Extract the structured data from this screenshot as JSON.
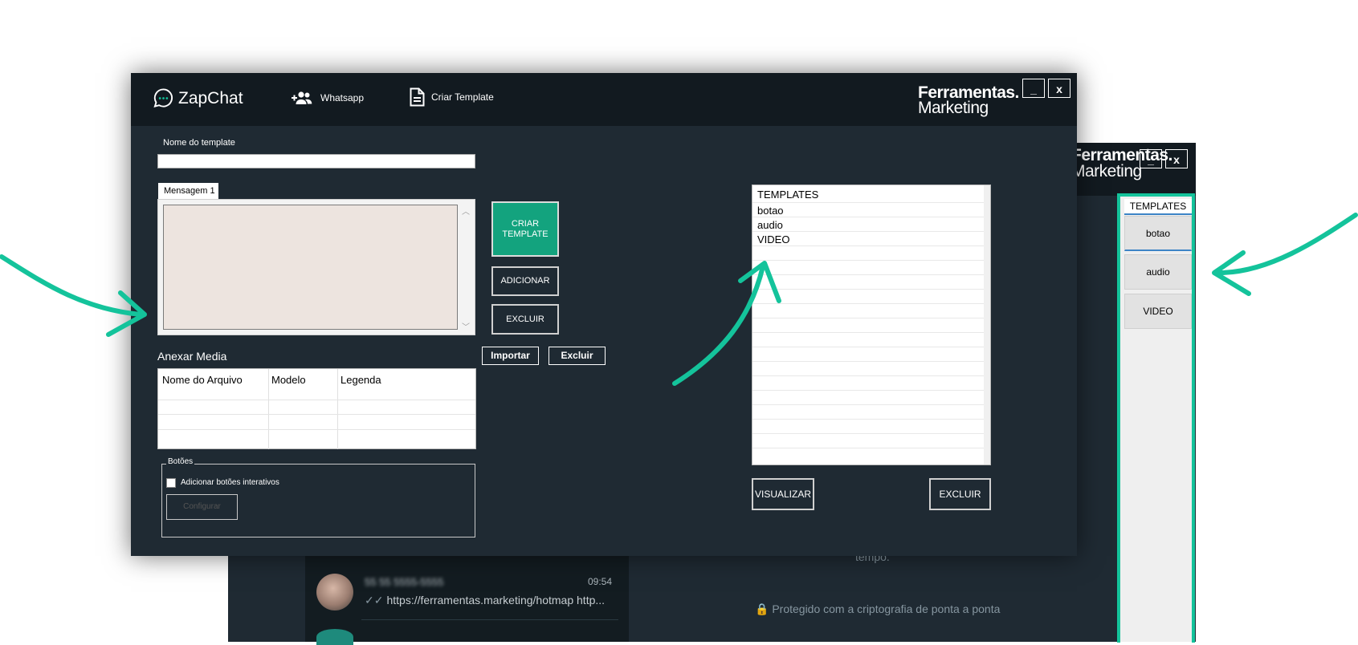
{
  "background_window": {
    "logo_line1": "Ferramentas.",
    "logo_line2": "Marketing",
    "min_label": "_",
    "close_label": "x",
    "chat": {
      "name": "55 55 5555-5555",
      "time": "09:54",
      "ticks": "✓✓",
      "message": "https://ferramentas.marketing/hotmap http..."
    },
    "center_text": "tempo.",
    "secure_text": "🔒 Protegido com a criptografia de ponta a ponta",
    "side_panel": {
      "header": "TEMPLATES",
      "items": [
        "botao",
        "audio",
        "VIDEO"
      ]
    }
  },
  "main_window": {
    "app_name": "ZapChat",
    "nav": {
      "whatsapp": "Whatsapp",
      "criar_template": "Criar Template"
    },
    "logo_line1": "Ferramentas.",
    "logo_line2": "Marketing",
    "min_label": "_",
    "close_label": "x",
    "form": {
      "name_label": "Nome do template",
      "name_value": "",
      "message_tab": "Mensagem 1",
      "message_value": "",
      "buttons": {
        "criar": "CRIAR TEMPLATE",
        "adicionar": "ADICIONAR",
        "excluir": "EXCLUIR"
      },
      "media": {
        "label": "Anexar Media",
        "importar": "Importar",
        "excluir": "Excluir",
        "columns": [
          "Nome do Arquivo",
          "Modelo",
          "Legenda"
        ]
      },
      "botoes": {
        "legend": "Botões",
        "checkbox_label": "Adicionar botões interativos",
        "configurar": "Configurar"
      }
    },
    "templates": {
      "header": "TEMPLATES",
      "items": [
        "botao",
        "audio",
        "VIDEO"
      ],
      "visualizar": "VISUALIZAR",
      "excluir": "EXCLUIR"
    }
  },
  "colors": {
    "accent": "#14c39b",
    "window_bg": "#1f2a33",
    "header_bg": "#121a20",
    "criar_button": "#13a37e"
  }
}
